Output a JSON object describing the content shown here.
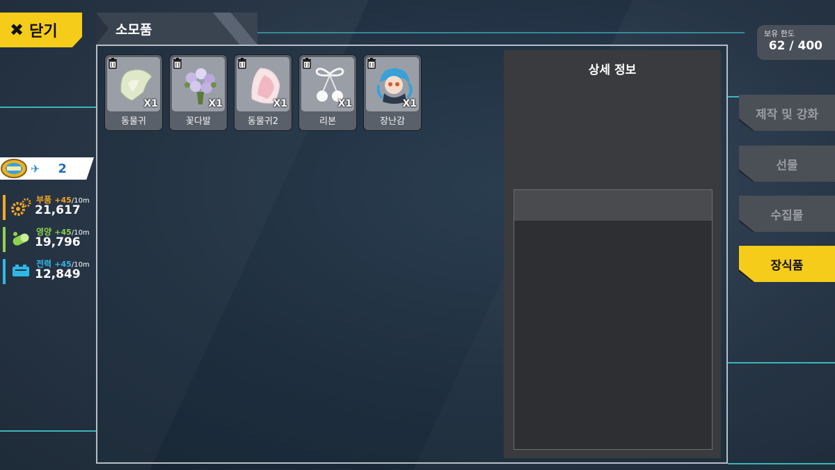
{
  "close_button": {
    "label": "닫기"
  },
  "panel": {
    "title": "소모품"
  },
  "items": [
    {
      "name": "동물귀",
      "qty": "X1"
    },
    {
      "name": "꽃다발",
      "qty": "X1"
    },
    {
      "name": "동물귀2",
      "qty": "X1"
    },
    {
      "name": "리본",
      "qty": "X1"
    },
    {
      "name": "장난감",
      "qty": "X1"
    }
  ],
  "detail": {
    "title": "상세 정보"
  },
  "capacity": {
    "label": "보유 한도",
    "value": "62 / 400"
  },
  "side_tabs": [
    {
      "label": "제작 및 강화",
      "active": false
    },
    {
      "label": "선물",
      "active": false
    },
    {
      "label": "수집물",
      "active": false
    },
    {
      "label": "장식품",
      "active": true
    }
  ],
  "player": {
    "level": "2"
  },
  "resources": [
    {
      "name": "부품",
      "rate": "+45",
      "per": "/10m",
      "amount": "21,617",
      "color": "#f5a623"
    },
    {
      "name": "영양",
      "rate": "+45",
      "per": "/10m",
      "amount": "19,796",
      "color": "#8fd14f"
    },
    {
      "name": "전력",
      "rate": "+45",
      "per": "/10m",
      "amount": "12,849",
      "color": "#2fb8e6"
    }
  ],
  "colors": {
    "accent": "#f5cc1a",
    "line": "#3fc4c8",
    "panel_border": "#b9bec6"
  },
  "icons": {
    "close": "close-x-icon",
    "trash": "trash-icon",
    "plane": "plane-icon"
  }
}
